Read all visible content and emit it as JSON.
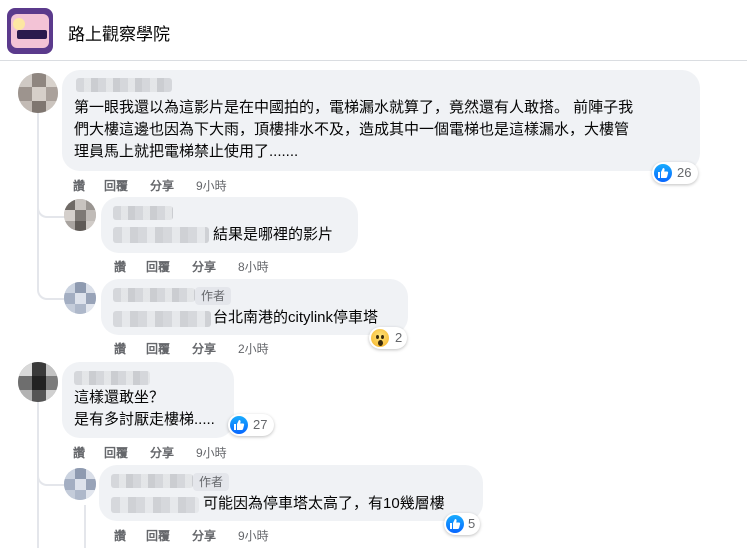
{
  "page": {
    "title": "路上觀察學院"
  },
  "comments": [
    {
      "text_lines": [
        "第一眼我還以為這影片是在中國拍的，電梯漏水就算了，竟然還有人敢搭。 前陣子我",
        "們大樓這邊也因為下大雨，頂樓排水不及，造成其中一個電梯也是這樣漏水，大樓管",
        "理員馬上就把電梯禁止使用了......."
      ],
      "actions": {
        "like": "讚",
        "reply": "回覆",
        "share": "分享",
        "time": "9小時"
      },
      "reaction_count": "26"
    },
    {
      "text": "結果是哪裡的影片",
      "actions": {
        "like": "讚",
        "reply": "回覆",
        "share": "分享",
        "time": "8小時"
      }
    },
    {
      "badge": "作者",
      "text": "台北南港的citylink停車塔",
      "actions": {
        "like": "讚",
        "reply": "回覆",
        "share": "分享",
        "time": "2小時"
      },
      "reaction_count": "2"
    },
    {
      "text_lines": [
        "這樣還敢坐？",
        "是有多討厭走樓梯....."
      ],
      "actions": {
        "like": "讚",
        "reply": "回覆",
        "share": "分享",
        "time": "9小時"
      },
      "reaction_count": "27"
    },
    {
      "badge": "作者",
      "text": "可能因為停車塔太高了，有10幾層樓",
      "actions": {
        "like": "讚",
        "reply": "回覆",
        "share": "分享",
        "time": "9小時"
      },
      "reaction_count": "5"
    }
  ],
  "icons": {
    "like": "like-icon",
    "wow": "wow-icon"
  },
  "colors": {
    "accent": "#0866ff",
    "bubble": "#f0f2f5",
    "secondary_text": "#65676b"
  }
}
